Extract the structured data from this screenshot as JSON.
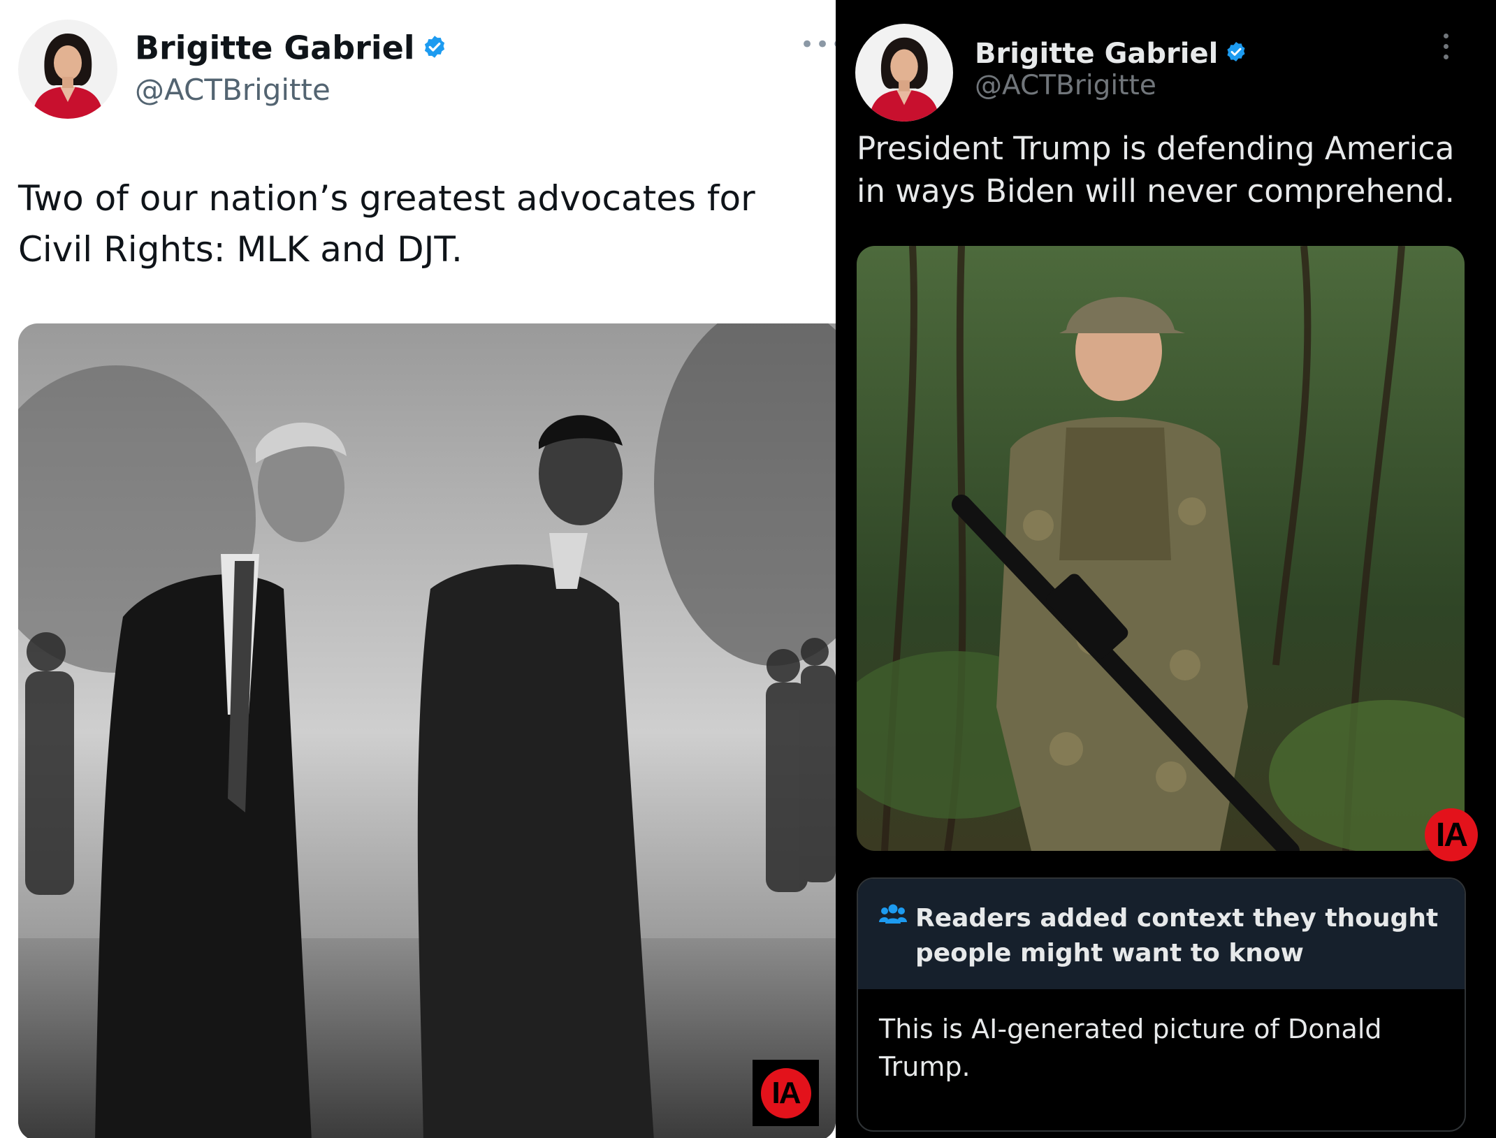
{
  "left_tweet": {
    "author_name": "Brigitte Gabriel",
    "handle": "@ACTBrigitte",
    "more_label": "•••",
    "text": "Two of our nation’s greatest advocates for Civil Rights: MLK and DJT.",
    "badge_label": "IA",
    "colors": {
      "verified": "#1d9bf0",
      "badge": "#e3121b"
    }
  },
  "right_tweet": {
    "author_name": "Brigitte Gabriel",
    "handle": "@ACTBrigitte",
    "text": "President Trump is defending America in ways Biden will never comprehend.",
    "badge_label": "IA",
    "community_note": {
      "header": "Readers added context they thought people might want to know",
      "body": "This is AI-generated picture of Donald Trump."
    },
    "colors": {
      "background": "#000000",
      "note_header_bg": "#16202c",
      "note_icon": "#1d9bf0"
    }
  }
}
